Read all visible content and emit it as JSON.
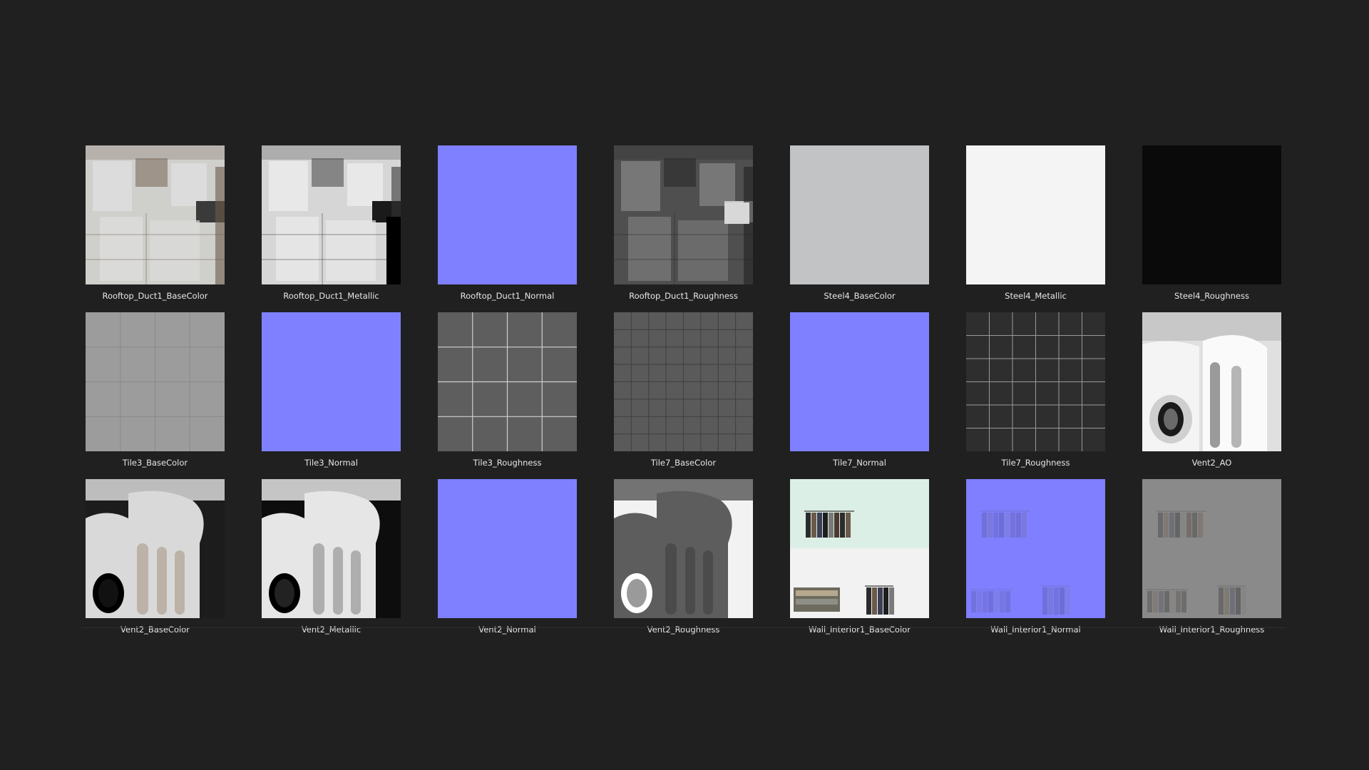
{
  "textures": [
    {
      "name": "Rooftop_Duct1_BaseColor",
      "kind": "duct-base"
    },
    {
      "name": "Rooftop_Duct1_Metallic",
      "kind": "duct-metal"
    },
    {
      "name": "Rooftop_Duct1_Normal",
      "kind": "normal"
    },
    {
      "name": "Rooftop_Duct1_Roughness",
      "kind": "duct-rough"
    },
    {
      "name": "Steel4_BaseColor",
      "kind": "flat-grey"
    },
    {
      "name": "Steel4_Metallic",
      "kind": "flat-white"
    },
    {
      "name": "Steel4_Roughness",
      "kind": "flat-black"
    },
    {
      "name": "Tile3_BaseColor",
      "kind": "tile-grey"
    },
    {
      "name": "Tile3_Normal",
      "kind": "normal"
    },
    {
      "name": "Tile3_Roughness",
      "kind": "tile-rough"
    },
    {
      "name": "Tile7_BaseColor",
      "kind": "tile-small"
    },
    {
      "name": "Tile7_Normal",
      "kind": "normal"
    },
    {
      "name": "Tile7_Roughness",
      "kind": "tile-dark"
    },
    {
      "name": "Vent2_AO",
      "kind": "vent-ao"
    },
    {
      "name": "Vent2_BaseColor",
      "kind": "vent-base"
    },
    {
      "name": "Vent2_Metallic",
      "kind": "vent-metal"
    },
    {
      "name": "Vent2_Normal",
      "kind": "normal"
    },
    {
      "name": "Vent2_Roughness",
      "kind": "vent-rough"
    },
    {
      "name": "Wall_Interior1_BaseColor",
      "kind": "wall-base"
    },
    {
      "name": "Wall_Interior1_Normal",
      "kind": "wall-normal"
    },
    {
      "name": "Wall_Interior1_Roughness",
      "kind": "wall-rough"
    }
  ],
  "colors": {
    "background": "#202020",
    "label": "#e6e6e6",
    "normal_map": "#8080ff"
  }
}
